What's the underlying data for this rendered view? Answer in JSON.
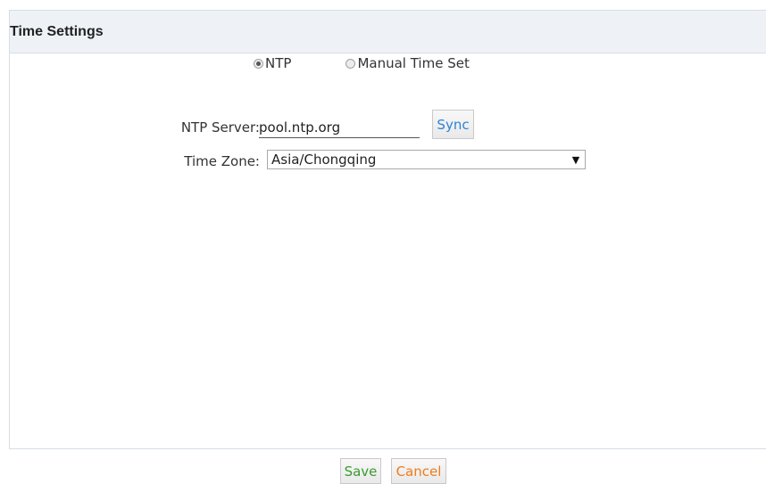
{
  "panel": {
    "title": "Time Settings"
  },
  "mode": {
    "options": [
      {
        "label": "NTP",
        "checked": true
      },
      {
        "label": "Manual Time Set",
        "checked": false
      }
    ]
  },
  "ntp": {
    "label": "NTP Server:",
    "value": "pool.ntp.org",
    "sync_label": "Sync"
  },
  "timezone": {
    "label": "Time Zone:",
    "value": "Asia/Chongqing",
    "arrow": "▼"
  },
  "footer": {
    "save_label": "Save",
    "cancel_label": "Cancel"
  },
  "colors": {
    "header_bg": "#eef2f6",
    "sync_text": "#2f82d6",
    "save_text": "#3a9b2f",
    "cancel_text": "#f07a1a"
  }
}
